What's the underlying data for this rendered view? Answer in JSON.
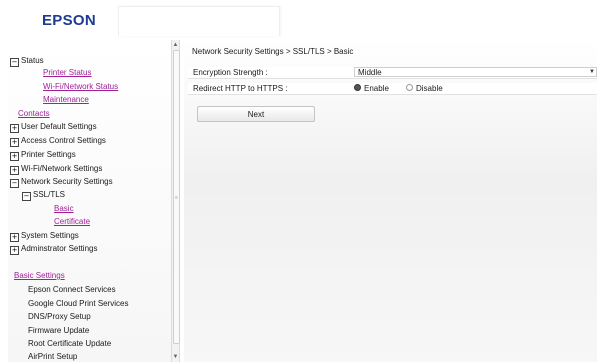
{
  "header": {
    "logo_text": "EPSON"
  },
  "sidebar": {
    "status": {
      "label": "Status",
      "toggle": "−"
    },
    "status_links": [
      "Printer Status",
      "Wi-Fi/Network Status",
      "Maintenance"
    ],
    "contacts": "Contacts",
    "sections": [
      {
        "label": "User Default Settings",
        "toggle": "+"
      },
      {
        "label": "Access Control Settings",
        "toggle": "+"
      },
      {
        "label": "Printer Settings",
        "toggle": "+"
      },
      {
        "label": "Wi-Fi/Network Settings",
        "toggle": "+"
      },
      {
        "label": "Network Security Settings",
        "toggle": "−"
      }
    ],
    "ssl_tls": {
      "label": "SSL/TLS",
      "toggle": "−"
    },
    "ssl_links": [
      "Basic",
      "Certificate"
    ],
    "more_sections": [
      {
        "label": "System Settings",
        "toggle": "+"
      },
      {
        "label": "Adminstrator Settings",
        "toggle": "+"
      }
    ],
    "basic_settings": "Basic Settings",
    "basic_items": [
      "Epson Connect Services",
      "Google Cloud Print Services",
      "DNS/Proxy Setup",
      "Firmware Update",
      "Root Certificate Update",
      "AirPrint Setup"
    ]
  },
  "main": {
    "breadcrumb": "Network Security Settings > SSL/TLS > Basic",
    "encryption": {
      "label": "Encryption Strength :",
      "value": "Middle"
    },
    "redirect": {
      "label": "Redirect HTTP to HTTPS :",
      "options": [
        "Enable",
        "Disable"
      ],
      "selected": "Enable"
    },
    "next_label": "Next"
  },
  "colors": {
    "link": "#a0209a",
    "logo": "#1f3a8f"
  }
}
